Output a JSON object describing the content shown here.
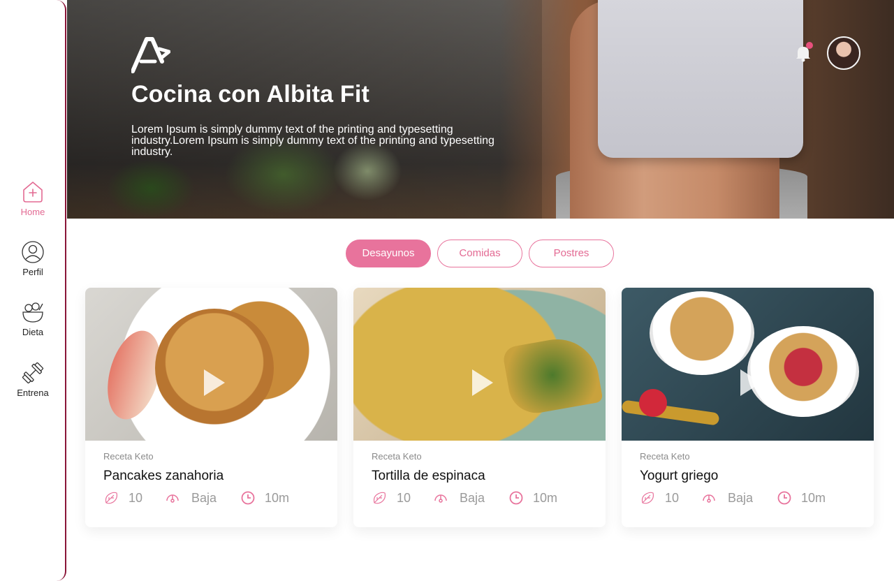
{
  "sidebar": {
    "items": [
      {
        "label": "Home",
        "icon": "home-icon",
        "active": true
      },
      {
        "label": "Perfil",
        "icon": "profile-icon",
        "active": false
      },
      {
        "label": "Dieta",
        "icon": "salad-bowl-icon",
        "active": false
      },
      {
        "label": "Entrena",
        "icon": "dumbbell-icon",
        "active": false
      }
    ]
  },
  "hero": {
    "title": "Cocina con Albita Fit",
    "description": "Lorem Ipsum is simply dummy text of the printing and typesetting industry.Lorem Ipsum is simply dummy text of the printing and typesetting industry."
  },
  "tabs": [
    {
      "label": "Desayunos",
      "active": true
    },
    {
      "label": "Comidas",
      "active": false
    },
    {
      "label": "Postres",
      "active": false
    }
  ],
  "recipes": [
    {
      "tag": "Receta Keto",
      "name": "Pancakes zanahoria",
      "ingredients": "10",
      "difficulty": "Baja",
      "time": "10m"
    },
    {
      "tag": "Receta Keto",
      "name": "Tortilla de espinaca",
      "ingredients": "10",
      "difficulty": "Baja",
      "time": "10m"
    },
    {
      "tag": "Receta Keto",
      "name": "Yogurt griego",
      "ingredients": "10",
      "difficulty": "Baja",
      "time": "10m"
    }
  ],
  "colors": {
    "accent": "#e8739c",
    "sidebar_border": "#8a1538",
    "notification": "#e8507d"
  }
}
